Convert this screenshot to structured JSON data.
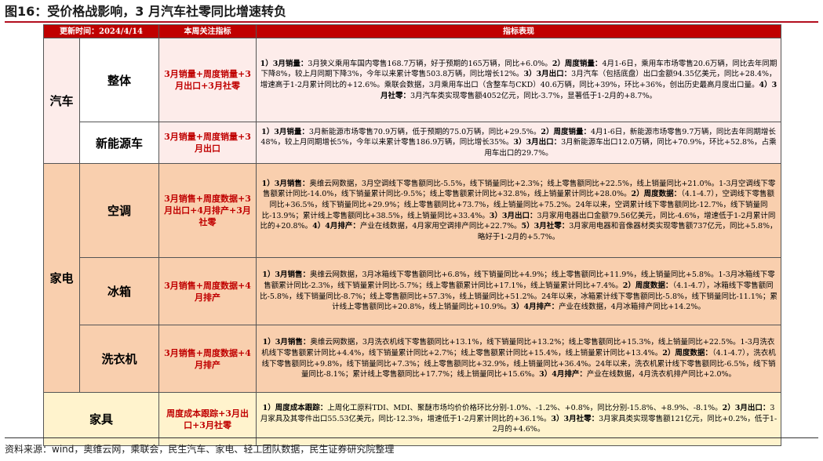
{
  "title": "图16：受价格战影响，3 月汽车社零同比增速转负",
  "source": "资料来源：wind，奥维云网，乘联会，民生汽车、家电、轻工团队数据，民生证券研究院整理",
  "header": {
    "col_update": "更新时间：2024/4/14",
    "col_focus": "本周关注指标",
    "col_perf": "指标表现"
  },
  "colors": {
    "header_bg": "#c00000",
    "accent_red": "#c00000",
    "auto_bg": "#fdecea",
    "appliance_bg": "#f9cfae",
    "furniture_bg": "#fff3cd"
  },
  "rows": [
    {
      "category": "汽车",
      "sub": "整体",
      "focus": "3月销量+周度销量+3月出口+3月社零",
      "desc": [
        {
          "b": "1）3月销量：",
          "t": "3月狭义乘用车国内零售168.7万辆，好于预期的165万辆，同比+6.0%。"
        },
        {
          "b": "2）周度销量：",
          "t": "4月1-6日，乘用车市场零售20.6万辆，同比去年同期下降8%，较上月同期下降3%，今年以来累计零售503.8万辆，同比增长12%。"
        },
        {
          "b": "3）3月出口：",
          "t": "3月汽车（包括底盘）出口金额94.35亿美元，同比+28.4%，增速高于1-2月累计同比的+12.6%。乘联会数据，3月乘用车出口（含整车与CKD）40.6万辆，同比+39%，环比+36%，创出历史最高月度出口量。"
        },
        {
          "b": "4）3月社零：",
          "t": "3月汽车类实现零售额4052亿元，同比-3.7%，显著低于1-2月的+8.7%。"
        }
      ]
    },
    {
      "sub": "新能源车",
      "focus": "3月销量+周度销量+3月出口",
      "desc": [
        {
          "b": "1）3月销量：",
          "t": "3月新能源市场零售70.9万辆，低于预期的75.0万辆，同比+29.5%。"
        },
        {
          "b": "2）周度销量：",
          "t": "4月1-6日，新能源市场零售9.7万辆，同比去年同期增长48%，较上月同期增长5%，今年以来累计零售186.9万辆，同比增长35%。"
        },
        {
          "b": "3）3月出口：",
          "t": "3月新能源车出口12.0万辆，同比+70.9%，环比+52.8%，占乘用车出口的29.7%。"
        }
      ]
    },
    {
      "category": "家电",
      "sub": "空调",
      "focus": "3月销售+周度数据+3月出口+4月排产+3月社零",
      "desc": [
        {
          "b": "1）3月销售：",
          "t": "奥维云网数据，3月空调线下零售额同比-5.5%，线下销量同比+2.3%；线上零售额同比+22.5%，线上销量同比+21.0%。1-3月空调线下零售额累计同比-14.0%，线下销量累计同比-9.5%；线上零售额累计同比+32.8%，线上销量累计同比+28.0%。"
        },
        {
          "b": "2）周度数据：",
          "t": "（4.1-4.7），空调线下零售额同比+36.5%，线下销量同比+29.9%；线上零售额同比+73.7%，线上销量同比+75.2%。24年以来，空调累计线下零售额同比-12.7%，线下销量同比-13.9%；累计线上零售额同比+38.5%，线上销量同比+33.4%。"
        },
        {
          "b": "3）3月出口：",
          "t": "3月家用电器出口金额79.56亿美元，同比-4.6%，增速低于1-2月累计同比的+20.8%。"
        },
        {
          "b": "4）4月排产：",
          "t": "产业在线数据，4月家用空调排产同比+22.7%。"
        },
        {
          "b": "5）3月社零：",
          "t": "3月家用电器和音像器材类实现零售额737亿元，同比+5.8%，略好于1-2月的+5.7%。"
        }
      ]
    },
    {
      "sub": "冰箱",
      "focus": "3月销售+周度数据+4月排产",
      "desc": [
        {
          "b": "1）3月销售：",
          "t": "奥维云网数据，3月冰箱线下零售额同比+6.8%，线下销量同比+4.9%；线上零售额同比+11.9%，线上销量同比+5.8%。1-3月冰箱线下零售额累计同比-2.3%，线下销量累计同比-5.7%；线上零售额累计同比+17.1%，线上销量累计同比+7.4%。"
        },
        {
          "b": "2）周度数据：",
          "t": "（4.1-4.7），冰箱线下零售额同比-5.8%，线下销量同比-8.7%；线上零售额同比+57.3%，线上销量同比+51.2%。24年以来，冰箱累计线下零售额同比-5.8%，线下销量同比-11.1%；累计线上零售额同比+20.8%，线上销量同比+10.9%。"
        },
        {
          "b": "3）4月排产：",
          "t": "产业在线数据，4月冰箱排产同比+14.2%。"
        }
      ]
    },
    {
      "sub": "洗衣机",
      "focus": "3月销售+周度数据+4月排产",
      "desc": [
        {
          "b": "1）3月销售：",
          "t": "奥维云网数据，3月洗衣机线下零售额同比+13.1%，线下销量同比+13.2%；线上零售额同比+15.3%，线上销量同比+22.5%。1-3月洗衣机线下零售额累计同比+4.4%，线下销量累计同比+2.7%；线上零售额累计同比+15.4%，线上销量累计同比+13.4%。"
        },
        {
          "b": "2）周度数据：",
          "t": "（4.1-4.7），洗衣机线下零售额同比+9.8%，线下销量同比+7.3%；线上零售额同比+32.9%，线上销量同比+36.4%。24年以来，洗衣机累计线下零售额同比-6.5%，线下销量同比-8.1%；累计线上零售额同比+17.7%；线上销量同比+15.6%。"
        },
        {
          "b": "3）4月排产：",
          "t": "产业在线数据，4月洗衣机排产同比+2.0%。"
        }
      ]
    },
    {
      "sub": "家具",
      "focus": "周度成本跟踪+3月出口+3月社零",
      "desc": [
        {
          "b": "1）周度成本跟踪：",
          "t": "上周化工原料TDI、MDI、聚醚市场均价价格环比分别-1.0%、-1.2%、+0.8%，同比分别-15.8%、+8.9%、-8.1%。"
        },
        {
          "b": "2）3月出口：",
          "t": "3月家具及其零件出口55.53亿美元，同比-12.3%，增速低于1-2月累计同比的+36.1%。"
        },
        {
          "b": "3）3月社零：",
          "t": "3月家具类实现零售额121亿元，同比+0.2%，低于1-2月的+4.6%。"
        }
      ]
    }
  ]
}
